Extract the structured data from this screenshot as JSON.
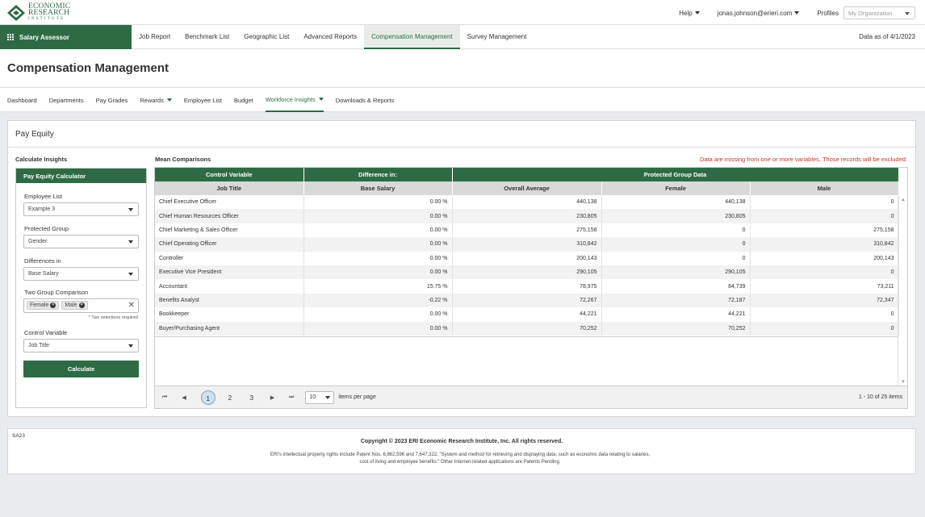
{
  "brand": {
    "logo_line1": "ECONOMIC",
    "logo_line2": "RESEARCH",
    "logo_line3": "INSTITUTE",
    "app_name": "Salary Assessor",
    "color": "#2e6b45"
  },
  "topbar": {
    "help": "Help",
    "user": "jonas.johnson@erieri.com",
    "profiles_label": "Profiles",
    "profiles_placeholder": "My Organization"
  },
  "nav": {
    "tabs": [
      "Job Report",
      "Benchmark List",
      "Geographic List",
      "Advanced Reports",
      "Compensation Management",
      "Survey Management"
    ],
    "active": "Compensation Management",
    "data_as_of": "Data as of 4/1/2023"
  },
  "page_title": "Compensation Management",
  "subnav": {
    "tabs": [
      "Dashboard",
      "Departments",
      "Pay Grades",
      "Rewards",
      "Employee List",
      "Budget",
      "Workforce Insights",
      "Downloads & Reports"
    ],
    "active": "Workforce Insights"
  },
  "panel": {
    "title": "Pay Equity",
    "calc_insights": "Calculate Insights",
    "calculator_title": "Pay Equity Calculator",
    "employee_list_label": "Employee List",
    "employee_list_value": "Example 3",
    "protected_group_label": "Protected Group",
    "protected_group_value": "Gender",
    "differences_label": "Differences in",
    "differences_value": "Base Salary",
    "two_group_label": "Two Group Comparison",
    "chips": [
      "Female",
      "Male"
    ],
    "two_group_note": "* Two selections required",
    "control_variable_label": "Control Variable",
    "control_variable_value": "Job Title",
    "calculate_button": "Calculate",
    "mean_comparisons": "Mean Comparisons",
    "warning": "Data are missing from one or more variables. Those records will be excluded."
  },
  "table": {
    "group_headers": [
      "Control Variable",
      "Difference in:",
      "Protected Group Data"
    ],
    "columns": [
      "Job Title",
      "Base Salary",
      "Overall Average",
      "Female",
      "Male"
    ],
    "rows": [
      [
        "Chief Executive Officer",
        "0.00 %",
        "440,138",
        "440,138",
        "0"
      ],
      [
        "Chief Human Resources Officer",
        "0.00 %",
        "230,805",
        "230,805",
        "0"
      ],
      [
        "Chief Marketing & Sales Officer",
        "0.00 %",
        "275,158",
        "0",
        "275,158"
      ],
      [
        "Chief Operating Officer",
        "0.00 %",
        "310,842",
        "0",
        "310,842"
      ],
      [
        "Controller",
        "0.00 %",
        "200,143",
        "0",
        "200,143"
      ],
      [
        "Executive Vice President",
        "0.00 %",
        "290,105",
        "290,105",
        "0"
      ],
      [
        "Accountant",
        "15.75 %",
        "78,975",
        "84,739",
        "73,211"
      ],
      [
        "Benefits Analyst",
        "-0.22 %",
        "72,267",
        "72,187",
        "72,347"
      ],
      [
        "Bookkeeper",
        "0.00 %",
        "44,221",
        "44,221",
        "0"
      ],
      [
        "Buyer/Purchasing Agent",
        "0.00 %",
        "70,252",
        "70,252",
        "0"
      ]
    ]
  },
  "pager": {
    "pages": [
      "1",
      "2",
      "3"
    ],
    "current": "1",
    "per_page": "10",
    "items_per_page": "items per page",
    "range": "1 - 10 of 25 items"
  },
  "footer": {
    "code": "SA23",
    "copyright": "Copyright © 2023 ERI Economic Research Institute, Inc. All rights reserved.",
    "patent": "ERI's intellectual property rights include Patent Nos. 6,862,596 and 7,647,322, \"System and method for retrieving and displaying data, such as economic data relating to salaries, cost of living and employee benefits.\" Other Internet-related applications are Patents Pending."
  }
}
